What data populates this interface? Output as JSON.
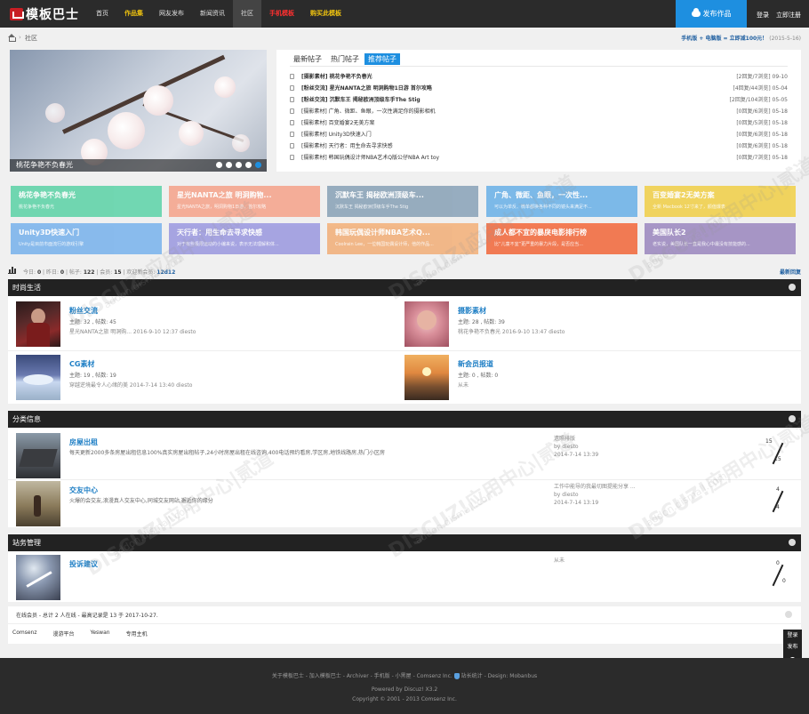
{
  "header": {
    "logo": "模板巴士",
    "nav": [
      {
        "label": "首页"
      },
      {
        "label": "作品集"
      },
      {
        "label": "网友发布"
      },
      {
        "label": "新闻资讯"
      },
      {
        "label": "社区"
      },
      {
        "label": "手机模板"
      },
      {
        "label": "购买此模板"
      }
    ],
    "publish": "发布作品",
    "login": "登录",
    "register": "立即注册"
  },
  "breadcrumb": {
    "sep": "›",
    "current": "社区",
    "promo": "手机版 + 电脑版 = 立即减100元！",
    "date": "(2015-5-16)"
  },
  "slider": {
    "caption": "桃花争艳不负春光",
    "slides": 5,
    "active": 5
  },
  "threads": {
    "tabs": [
      "最新帖子",
      "热门帖子",
      "推荐帖子"
    ],
    "active_tab": 2,
    "items": [
      {
        "title": "[摄影素材] 桃花争艳不负春光",
        "meta": "[2回复/7浏览]  09-10",
        "bold": true
      },
      {
        "title": "[粉丝交流] 星光NANTA之旅 明洞购物1日游 首尔攻略",
        "meta": "[4回复/44浏览]  05-04",
        "bold": true
      },
      {
        "title": "[粉丝交流] 沉默车王 揭秘欧洲顶级车手The Stig",
        "meta": "[2回复/104浏览]  05-05",
        "bold": true
      },
      {
        "title": "[摄影素材] 广角、微距、鱼眼，一次性满足你的摄影相机",
        "meta": "[0回复/6浏览]  05-18",
        "bold": false
      },
      {
        "title": "[摄影素材] 百变婚宴2无美方案",
        "meta": "[0回复/5浏览]  05-18",
        "bold": false
      },
      {
        "title": "[摄影素材] Unity3D快速入门",
        "meta": "[0回复/6浏览]  05-18",
        "bold": false
      },
      {
        "title": "[摄影素材] 天行者：用生命去寻求快感",
        "meta": "[0回复/6浏览]  05-18",
        "bold": false
      },
      {
        "title": "[摄影素材] 韩国玩偶设计师NBA艺术Q版公仔NBA Art toy",
        "meta": "[0回复/7浏览]  05-18",
        "bold": false
      }
    ]
  },
  "blocks": [
    {
      "title": "桃花争艳不负春光",
      "desc": "桃花争艳不负春光",
      "color": "#5fd3a8"
    },
    {
      "title": "星光NANTA之旅 明洞购物...",
      "desc": "星光NANTA之旅，明洞购物1日游，首尔攻略",
      "color": "#f5a48c"
    },
    {
      "title": "沉默车王 揭秘欧洲顶级车...",
      "desc": "沉默车王 揭秘欧洲顶级车手The Stig",
      "color": "#8aa3b8"
    },
    {
      "title": "广角、微距、鱼眼，一次性...",
      "desc": "可以为单反、微单都换各种不同的镜头来满足不...",
      "color": "#6db2e8"
    },
    {
      "title": "百变婚宴2无美方案",
      "desc": "全新 Macbook 12寸来了，颜值爆表",
      "color": "#f0d04a"
    },
    {
      "title": "Unity3D快速入门",
      "desc": "Unity是目前市面流行的游戏引擎",
      "color": "#7ab3ec"
    },
    {
      "title": "天行者：用生命去寻求快感",
      "desc": "对于有些极限运动的小编来说，表示无法理解和体...",
      "color": "#9c9ae0"
    },
    {
      "title": "韩国玩偶设计师NBA艺术Q...",
      "desc": "Coolrain Lee，一位韩国玩偶设计师，他的作品...",
      "color": "#f2b07a"
    },
    {
      "title": "成人都不宜的暴戾电影排行榜",
      "desc": "比“儿童不宜”更严重的暴力片段，是否应当...",
      "color": "#f26a3e"
    },
    {
      "title": "美国队长2",
      "desc": "老实说，美国队长一直是我心中最没有技能感的...",
      "color": "#9c89c0"
    }
  ],
  "stats": {
    "today": "0",
    "yesterday": "0",
    "posts": "122",
    "members": "15",
    "newest": "12d12",
    "latest_link": "最新回复"
  },
  "sections": [
    {
      "title": "时尚生活",
      "forums": [
        {
          "name": "粉丝交流",
          "stat": "主题: 32 , 帖数: 45",
          "last": "星光NANTA之旅 明洞购...    2016-9-10 12:37 diesto"
        },
        {
          "name": "摄影素材",
          "stat": "主题: 28 , 帖数: 39",
          "last": "桃花争艳不负春光             2016-9-10 13:47 diesto"
        },
        {
          "name": "CG素材",
          "stat": "主题: 19 , 帖数: 19",
          "last": "穿越逆境最令人心绪的美    2014-7-14 13:40 diesto"
        },
        {
          "name": "新会员报道",
          "stat": "主题: 0 , 帖数: 0",
          "last": "从未"
        }
      ]
    },
    {
      "title": "分类信息",
      "forums": [
        {
          "name": "房屋出租",
          "desc": "每天更新2000多条房屋出租信息100%真实房屋出租帖子,24小时房屋出租在线咨询,400电话预约看房,学区房,地铁线路房,热门小区房",
          "last1": "遗照排版",
          "last2": "by diesto",
          "last3": "2014-7-14 13:39",
          "c1": "15",
          "c2": "15"
        },
        {
          "name": "交友中心",
          "desc": "火爆的会交友,浪漫真人交友中心,同城交友网站,邂逅你的缘分",
          "last1": "工作中能导的我最切图提能分享 ...",
          "last2": "by diesto",
          "last3": "2014-7-14 13:19",
          "c1": "4",
          "c2": "4"
        }
      ]
    },
    {
      "title": "站务管理",
      "forums": [
        {
          "name": "投诉建议",
          "desc": "",
          "last1": "从未",
          "last2": "",
          "last3": "",
          "c1": "0",
          "c2": "0"
        }
      ]
    }
  ],
  "online": {
    "text": "在线会员 - 总计 2 人在线 - 最高记录是 13 于 2017-10-27.",
    "links": [
      "Comsenz",
      "漫游平台",
      "Yeswan",
      "专用主机"
    ]
  },
  "float": [
    "登录",
    "发布"
  ],
  "footer": {
    "line1": "关于模板巴士 - 加入模板巴士 - Archiver - 手机版 - 小黑屋 - Comsenz Inc.",
    "line1b": "站长统计 - Design: Mobanbus",
    "line2": "Powered by Discuz! X3.2",
    "line3": "Copyright © 2001 - 2013 Comsenz Inc."
  },
  "watermark": "DISCUZ!应用中心|贰道",
  "watermark_url": "addon.dismall.com"
}
